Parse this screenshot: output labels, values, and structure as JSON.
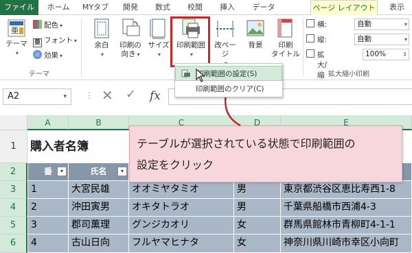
{
  "tabs": [
    "ファイル",
    "ホーム",
    "MYタブ",
    "開発",
    "数式",
    "校閲",
    "挿入",
    "データ",
    "ページ レイアウト",
    "表示"
  ],
  "theme_group": {
    "label": "テーマ",
    "theme_button": "テーマ",
    "colors": "配色",
    "fonts": "フォント",
    "effects": "効果"
  },
  "page_setup": {
    "margins": "余白",
    "orientation_l1": "印刷の",
    "orientation_l2": "向き",
    "size": "サイズ",
    "print_area": "印刷範囲",
    "breaks": "改ページ",
    "background": "背景",
    "print_titles_l1": "印刷",
    "print_titles_l2": "タイトル"
  },
  "scale": {
    "label": "拡大縮小印刷",
    "width_label": "横:",
    "width_value": "自動",
    "height_label": "縦:",
    "height_value": "自動",
    "zoom_label": "拡大/縮小:",
    "zoom_value": "100%"
  },
  "menu": {
    "set_print_area": "印刷範囲の設定(S)",
    "clear_print_area": "印刷範囲のクリア(C)"
  },
  "formula_bar": {
    "name_box": "A2",
    "fx": "fx",
    "cancel": "✕",
    "enter": "✓"
  },
  "columns": [
    "A",
    "B",
    "C",
    "D",
    "E"
  ],
  "rows": [
    "1",
    "2",
    "3",
    "4",
    "5",
    "6"
  ],
  "sheet": {
    "title": "購入者名簿",
    "headers": [
      "番",
      "氏名"
    ],
    "data": [
      [
        "1",
        "大宮民雄",
        "オオミヤタミオ",
        "男",
        "東京都渋谷区恵比寿西1-8"
      ],
      [
        "2",
        "沖田寅男",
        "オキタトラオ",
        "男",
        "千葉県船橋市西浦4-3"
      ],
      [
        "3",
        "郡司薫理",
        "グンジカオリ",
        "女",
        "群馬県館林市青柳町4-1-1"
      ],
      [
        "4",
        "古山日向",
        "フルヤマヒナタ",
        "女",
        "神奈川県川崎市幸区小向町"
      ]
    ]
  },
  "callout": {
    "line1": "テーブルが選択されている状態で印刷範囲の",
    "line2": "設定をクリック"
  }
}
